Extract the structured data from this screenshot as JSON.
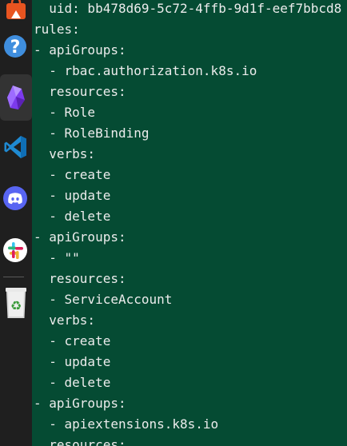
{
  "dock": {
    "items": [
      {
        "name": "ubuntu-software",
        "icon": "shopping-bag-icon"
      },
      {
        "name": "help",
        "icon": "help-icon"
      },
      {
        "name": "obsidian",
        "icon": "obsidian-icon"
      },
      {
        "name": "vscode",
        "icon": "vscode-icon"
      },
      {
        "name": "discord",
        "icon": "discord-icon"
      },
      {
        "name": "slack",
        "icon": "slack-icon"
      },
      {
        "name": "trash",
        "icon": "trash-icon"
      }
    ],
    "colors": {
      "background": "#1f1f1f",
      "software": "#e95420",
      "help": "#3f8ede",
      "obsidian": "#7c3aed",
      "vscode": "#1f8ad2",
      "discord": "#5865f2",
      "trash_recycle": "#3a9a3a"
    }
  },
  "terminal": {
    "background": "#054b33",
    "foreground": "#ececec",
    "lines": [
      "  uid: bb478d69-5c72-4ffb-9d1f-eef7bbcd8",
      "rules:",
      "- apiGroups:",
      "  - rbac.authorization.k8s.io",
      "  resources:",
      "  - Role",
      "  - RoleBinding",
      "  verbs:",
      "  - create",
      "  - update",
      "  - delete",
      "- apiGroups:",
      "  - \"\"",
      "  resources:",
      "  - ServiceAccount",
      "  verbs:",
      "  - create",
      "  - update",
      "  - delete",
      "- apiGroups:",
      "  - apiextensions.k8s.io",
      "  resources:"
    ]
  }
}
